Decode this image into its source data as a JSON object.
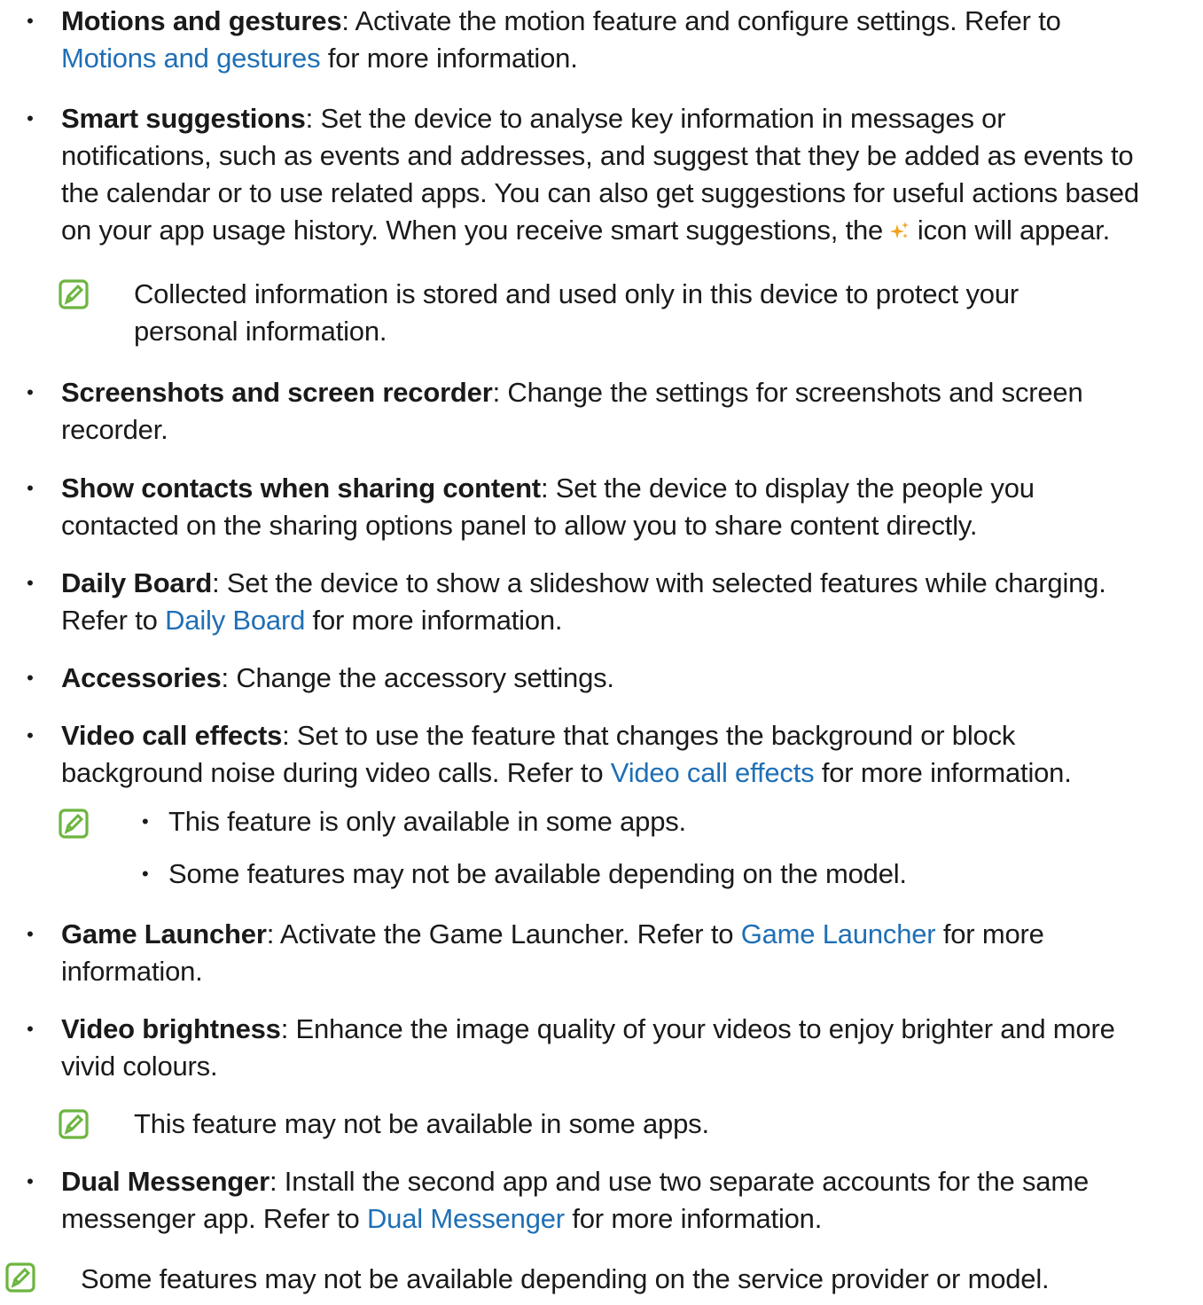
{
  "colors": {
    "link": "#1f6fb5",
    "note_icon": "#6cb53f",
    "sparkle_icon": "#f3a21b"
  },
  "bullet": "•",
  "items": {
    "motions": {
      "title": "Motions and gestures",
      "t1": ": Activate the motion feature and configure settings. Refer to",
      "link": "Motions and gestures",
      "t2": " for more information."
    },
    "smart": {
      "title": "Smart suggestions",
      "line1": ": Set the device to analyse key information in messages or",
      "line2": "notifications, such as events and addresses, and suggest that they be added as events to",
      "line3": "the calendar or to use related apps. You can also get suggestions for useful actions based",
      "line4a": "on your app usage history. When you receive smart suggestions, the ",
      "line4b": " icon will appear.",
      "note_line1": "Collected information is stored and used only in this device to protect your",
      "note_line2": "personal information."
    },
    "screenshots": {
      "title": "Screenshots and screen recorder",
      "line1": ": Change the settings for screenshots and screen",
      "line2": "recorder."
    },
    "contacts": {
      "title": "Show contacts when sharing content",
      "line1": ": Set the device to display the people you",
      "line2": "contacted on the sharing options panel to allow you to share content directly."
    },
    "daily": {
      "title": "Daily Board",
      "line1": ": Set the device to show a slideshow with selected features while charging.",
      "t2a": "Refer to ",
      "link": "Daily Board",
      "t2b": " for more information."
    },
    "accessories": {
      "title": "Accessories",
      "line1": ": Change the accessory settings."
    },
    "video_call": {
      "title": "Video call effects",
      "line1": ": Set to use the feature that changes the background or block",
      "t2a": "background noise during video calls. Refer to ",
      "link": "Video call effects",
      "t2b": " for more information.",
      "note1": "This feature is only available in some apps.",
      "note2": "Some features may not be available depending on the model."
    },
    "game": {
      "title": "Game Launcher",
      "t1a": ": Activate the Game Launcher. Refer to ",
      "link": "Game Launcher",
      "t1b": " for more",
      "line2": "information."
    },
    "video_brightness": {
      "title": "Video brightness",
      "line1": ": Enhance the image quality of your videos to enjoy brighter and more",
      "line2": "vivid colours.",
      "note": "This feature may not be available in some apps."
    },
    "dual": {
      "title": "Dual Messenger",
      "line1": ": Install the second app and use two separate accounts for the same",
      "t2a": "messenger app. Refer to ",
      "link": "Dual Messenger",
      "t2b": " for more information."
    }
  },
  "footer_note": "Some features may not be available depending on the service provider or model."
}
